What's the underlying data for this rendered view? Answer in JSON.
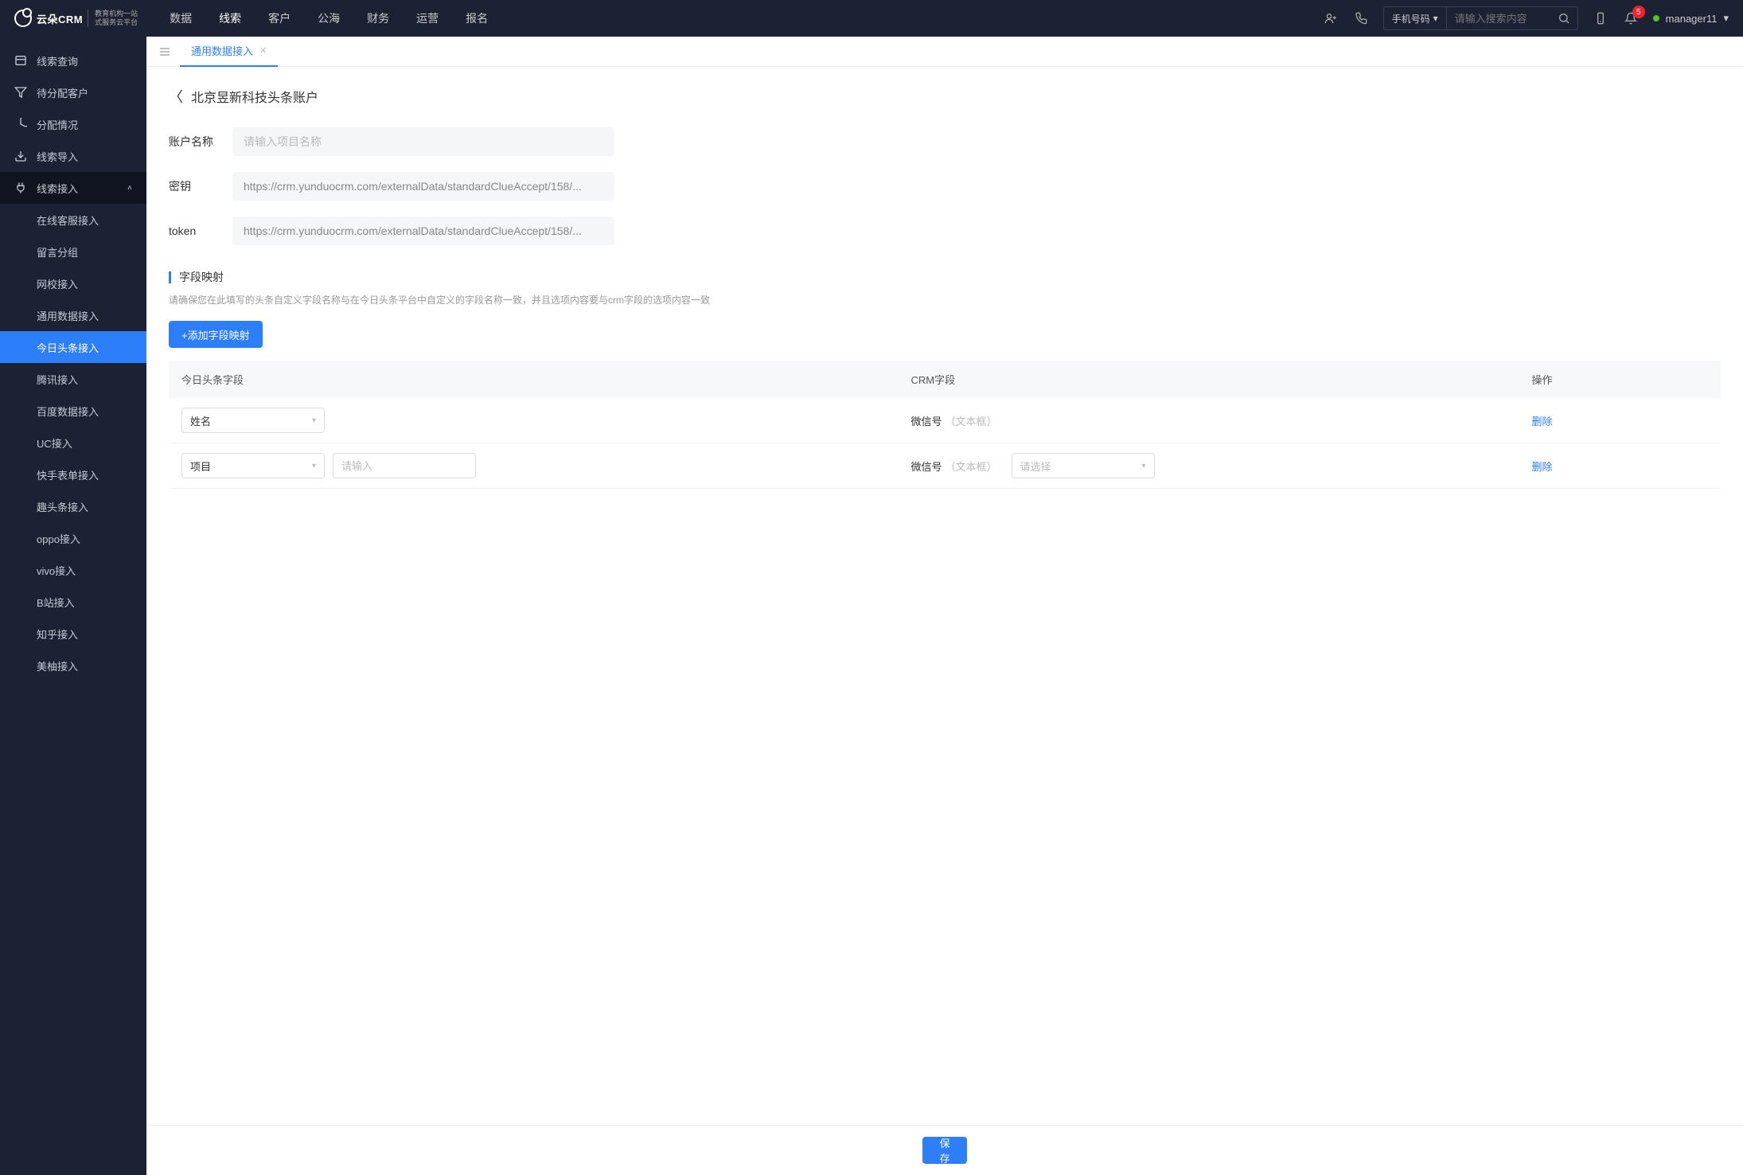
{
  "header": {
    "logo_text": "云朵CRM",
    "logo_sub": "教育机构一站\n式服务云平台",
    "nav": [
      "数据",
      "线索",
      "客户",
      "公海",
      "财务",
      "运营",
      "报名"
    ],
    "nav_active": 1,
    "search_type": "手机号码",
    "search_placeholder": "请输入搜索内容",
    "notif_count": "5",
    "username": "manager11"
  },
  "sidebar": {
    "items": [
      {
        "icon": "list",
        "label": "线索查询"
      },
      {
        "icon": "filter",
        "label": "待分配客户"
      },
      {
        "icon": "pie",
        "label": "分配情况"
      },
      {
        "icon": "import",
        "label": "线索导入"
      },
      {
        "icon": "plug",
        "label": "线索接入",
        "expanded": true,
        "children": [
          "在线客服接入",
          "留言分组",
          "网校接入",
          "通用数据接入",
          "今日头条接入",
          "腾讯接入",
          "百度数据接入",
          "UC接入",
          "快手表单接入",
          "趣头条接入",
          "oppo接入",
          "vivo接入",
          "B站接入",
          "知乎接入",
          "美柚接入"
        ],
        "active_child": 4
      }
    ]
  },
  "tabs": {
    "items": [
      "通用数据接入"
    ]
  },
  "page": {
    "title": "北京昱新科技头条账户",
    "form": {
      "lbl_name": "账户名称",
      "ph_name": "请输入项目名称",
      "lbl_key": "密钥",
      "val_key": "https://crm.yunduocrm.com/externalData/standardClueAccept/158/...",
      "lbl_token": "token",
      "val_token": "https://crm.yunduocrm.com/externalData/standardClueAccept/158/..."
    },
    "section": {
      "title": "字段映射",
      "desc": "请确保您在此填写的头条自定义字段名称与在今日头条平台中自定义的字段名称一致，并且选项内容要与crm字段的选项内容一致",
      "add_btn": "+添加字段映射"
    },
    "table": {
      "cols": [
        "今日头条字段",
        "CRM字段",
        "操作"
      ],
      "rows": [
        {
          "tt_field": "姓名",
          "crm_field": "微信号",
          "crm_type": "（文本框）",
          "delete": "删除"
        },
        {
          "tt_field": "项目",
          "tt_extra_ph": "请输入",
          "crm_field": "微信号",
          "crm_type": "（文本框）",
          "crm_sel_ph": "请选择",
          "delete": "删除"
        }
      ]
    },
    "save_btn": "保存"
  }
}
